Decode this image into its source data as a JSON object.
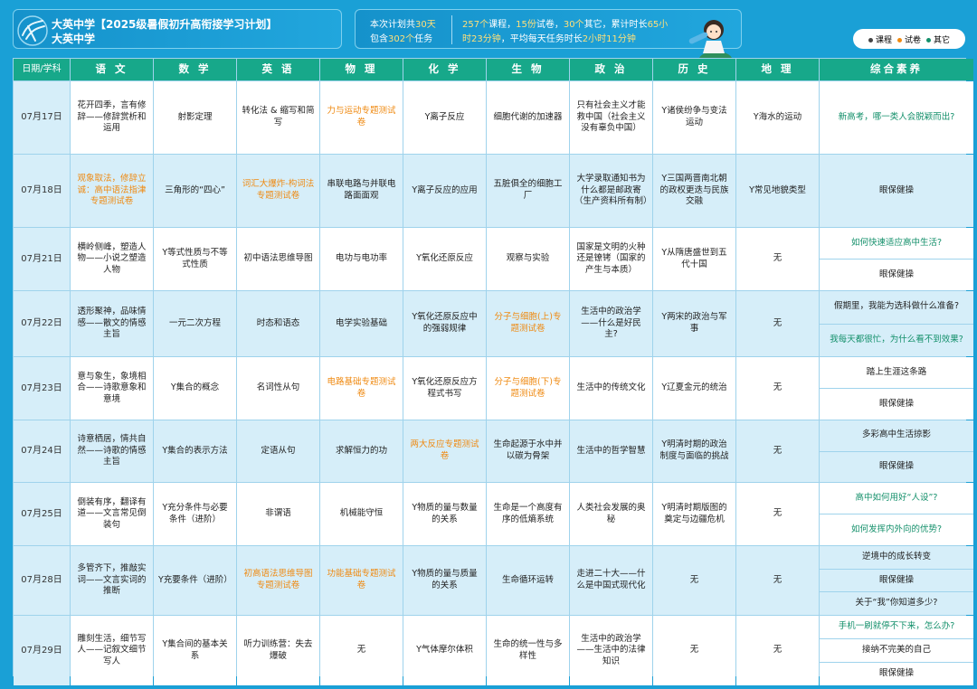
{
  "header": {
    "title_line1": "大英中学【2025级暑假初升高衔接学习计划】",
    "title_line2": "大英中学",
    "plan_days_prefix": "本次计划共",
    "plan_days_value": "30天",
    "plan_tasks_prefix": "包含",
    "plan_tasks_value": "302个",
    "plan_tasks_suffix": "任务",
    "stat_courses_value": "257个",
    "stat_courses_label": "课程，",
    "stat_papers_value": "15份",
    "stat_papers_label": "试卷，",
    "stat_others_value": "30个",
    "stat_others_label": "其它，累计时长",
    "stat_total_value1": "65小",
    "stat_total_value2": "时23分钟",
    "stat_avg_label": "，平均每天任务时长",
    "stat_avg_value": "2小时11分钟"
  },
  "legend": [
    {
      "label": "课程",
      "color": "#444444"
    },
    {
      "label": "试卷",
      "color": "#ef8a12"
    },
    {
      "label": "其它",
      "color": "#14906b"
    }
  ],
  "columns": [
    "日期/学科",
    "语 文",
    "数 学",
    "英 语",
    "物 理",
    "化 学",
    "生 物",
    "政 治",
    "历 史",
    "地 理",
    "综合素养"
  ],
  "rows": [
    {
      "date": "07月17日",
      "shade": "w",
      "cells": [
        {
          "t": "花开四季，言有修辞——修辞赏析和运用",
          "k": "c"
        },
        {
          "t": "射影定理",
          "k": "c"
        },
        {
          "t": "转化法 & 缩写和简写",
          "k": "c"
        },
        {
          "t": "力与运动专题测试卷",
          "k": "p"
        },
        {
          "t": "Y离子反应",
          "k": "c"
        },
        {
          "t": "细胞代谢的加速器",
          "k": "c"
        },
        {
          "t": "只有社会主义才能救中国（社会主义没有辜负中国）",
          "k": "c"
        },
        {
          "t": "Y诸侯纷争与变法运动",
          "k": "c"
        },
        {
          "t": "Y海水的运动",
          "k": "c"
        }
      ],
      "extra": [
        {
          "t": "新高考，哪一类人会脱颖而出?",
          "k": "o"
        }
      ]
    },
    {
      "date": "07月18日",
      "shade": "b",
      "cells": [
        {
          "t": "观象取法，修辞立诚：高中语法指津专题测试卷",
          "k": "p"
        },
        {
          "t": "三角形的“四心”",
          "k": "c"
        },
        {
          "t": "词汇大爆炸-构词法专题测试卷",
          "k": "p"
        },
        {
          "t": "串联电路与并联电路面面观",
          "k": "c"
        },
        {
          "t": "Y离子反应的应用",
          "k": "c"
        },
        {
          "t": "五脏俱全的细胞工厂",
          "k": "c"
        },
        {
          "t": "大学录取通知书为什么都是邮政寄（生产资料所有制）",
          "k": "c"
        },
        {
          "t": "Y三国两晋南北朝的政权更迭与民族交融",
          "k": "c"
        },
        {
          "t": "Y常见地貌类型",
          "k": "c"
        }
      ],
      "extra": [
        {
          "t": "眼保健操",
          "k": "c"
        }
      ]
    },
    {
      "date": "07月21日",
      "shade": "w",
      "cells": [
        {
          "t": "横岭侧峰，塑造人物——小说之塑造人物",
          "k": "c"
        },
        {
          "t": "Y等式性质与不等式性质",
          "k": "c"
        },
        {
          "t": "初中语法思维导图",
          "k": "c"
        },
        {
          "t": "电功与电功率",
          "k": "c"
        },
        {
          "t": "Y氧化还原反应",
          "k": "c"
        },
        {
          "t": "观察与实验",
          "k": "c"
        },
        {
          "t": "国家是文明的火种还是镣铐（国家的产生与本质）",
          "k": "c"
        },
        {
          "t": "Y从隋唐盛世到五代十国",
          "k": "c"
        },
        {
          "t": "无",
          "k": "c"
        }
      ],
      "extra": [
        {
          "t": "如何快速适应高中生活?",
          "k": "o"
        },
        {
          "t": "眼保健操",
          "k": "c"
        }
      ]
    },
    {
      "date": "07月22日",
      "shade": "b",
      "cells": [
        {
          "t": "透形聚神，品味情感——散文的情感主旨",
          "k": "c"
        },
        {
          "t": "一元二次方程",
          "k": "c"
        },
        {
          "t": "时态和语态",
          "k": "c"
        },
        {
          "t": "电学实验基础",
          "k": "c"
        },
        {
          "t": "Y氧化还原反应中的强弱规律",
          "k": "c"
        },
        {
          "t": "分子与细胞(上)专题测试卷",
          "k": "p"
        },
        {
          "t": "生活中的政治学——什么是好民主?",
          "k": "c"
        },
        {
          "t": "Y两宋的政治与军事",
          "k": "c"
        },
        {
          "t": "无",
          "k": "c"
        }
      ],
      "extra": [
        {
          "t": "假期里，我能为选科做什么准备?",
          "k": "c"
        },
        {
          "t": "我每天都很忙，为什么看不到效果?",
          "k": "o"
        }
      ]
    },
    {
      "date": "07月23日",
      "shade": "w",
      "cells": [
        {
          "t": "意与象生，象境相合——诗歌意象和意境",
          "k": "c"
        },
        {
          "t": "Y集合的概念",
          "k": "c"
        },
        {
          "t": "名词性从句",
          "k": "c"
        },
        {
          "t": "电路基础专题测试卷",
          "k": "p"
        },
        {
          "t": "Y氧化还原反应方程式书写",
          "k": "c"
        },
        {
          "t": "分子与细胞(下)专题测试卷",
          "k": "p"
        },
        {
          "t": "生活中的传统文化",
          "k": "c"
        },
        {
          "t": "Y辽夏金元的统治",
          "k": "c"
        },
        {
          "t": "无",
          "k": "c"
        }
      ],
      "extra": [
        {
          "t": "踏上生涯这条路",
          "k": "c"
        },
        {
          "t": "眼保健操",
          "k": "c"
        }
      ]
    },
    {
      "date": "07月24日",
      "shade": "b",
      "cells": [
        {
          "t": "诗意栖居，情共自然——诗歌的情感主旨",
          "k": "c"
        },
        {
          "t": "Y集合的表示方法",
          "k": "c"
        },
        {
          "t": "定语从句",
          "k": "c"
        },
        {
          "t": "求解恒力的功",
          "k": "c"
        },
        {
          "t": "两大反应专题测试卷",
          "k": "p"
        },
        {
          "t": "生命起源于水中并以碳为骨架",
          "k": "c"
        },
        {
          "t": "生活中的哲学智慧",
          "k": "c"
        },
        {
          "t": "Y明清时期的政治制度与面临的挑战",
          "k": "c"
        },
        {
          "t": "无",
          "k": "c"
        }
      ],
      "extra": [
        {
          "t": "多彩高中生活掠影",
          "k": "c"
        },
        {
          "t": "眼保健操",
          "k": "c"
        }
      ]
    },
    {
      "date": "07月25日",
      "shade": "w",
      "cells": [
        {
          "t": "倒装有序，翻译有道——文言常见倒装句",
          "k": "c"
        },
        {
          "t": "Y充分条件与必要条件（进阶）",
          "k": "c"
        },
        {
          "t": "非谓语",
          "k": "c"
        },
        {
          "t": "机械能守恒",
          "k": "c"
        },
        {
          "t": "Y物质的量与数量的关系",
          "k": "c"
        },
        {
          "t": "生命是一个高度有序的低熵系统",
          "k": "c"
        },
        {
          "t": "人类社会发展的奥秘",
          "k": "c"
        },
        {
          "t": "Y明清时期版图的奠定与边疆危机",
          "k": "c"
        },
        {
          "t": "无",
          "k": "c"
        }
      ],
      "extra": [
        {
          "t": "高中如何用好“人设”?",
          "k": "o"
        },
        {
          "t": "如何发挥内外向的优势?",
          "k": "o"
        }
      ]
    },
    {
      "date": "07月28日",
      "shade": "b",
      "cells": [
        {
          "t": "多管齐下，推敲实词——文言实词的推断",
          "k": "c"
        },
        {
          "t": "Y充要条件（进阶）",
          "k": "c"
        },
        {
          "t": "初高语法思维导图专题测试卷",
          "k": "p"
        },
        {
          "t": "功能基础专题测试卷",
          "k": "p"
        },
        {
          "t": "Y物质的量与质量的关系",
          "k": "c"
        },
        {
          "t": "生命循环运转",
          "k": "c"
        },
        {
          "t": "走进二十大——什么是中国式现代化",
          "k": "c"
        },
        {
          "t": "无",
          "k": "c"
        },
        {
          "t": "无",
          "k": "c"
        }
      ],
      "extra": [
        {
          "t": "逆境中的成长转变",
          "k": "c"
        },
        {
          "t": "眼保健操",
          "k": "c"
        },
        {
          "t": "关于“我”你知道多少?",
          "k": "c"
        }
      ]
    },
    {
      "date": "07月29日",
      "shade": "w",
      "cells": [
        {
          "t": "雕刻生活，细节写人——记叙文细节写人",
          "k": "c"
        },
        {
          "t": "Y集合间的基本关系",
          "k": "c"
        },
        {
          "t": "听力训练营：失去爆破",
          "k": "c"
        },
        {
          "t": "无",
          "k": "c"
        },
        {
          "t": "Y气体摩尔体积",
          "k": "c"
        },
        {
          "t": "生命的统一性与多样性",
          "k": "c"
        },
        {
          "t": "生活中的政治学——生活中的法律知识",
          "k": "c"
        },
        {
          "t": "无",
          "k": "c"
        },
        {
          "t": "无",
          "k": "c"
        }
      ],
      "extra": [
        {
          "t": "手机一刷就停不下来，怎么办?",
          "k": "o"
        },
        {
          "t": "接纳不完美的自己",
          "k": "c"
        },
        {
          "t": "眼保健操",
          "k": "c"
        }
      ]
    }
  ]
}
